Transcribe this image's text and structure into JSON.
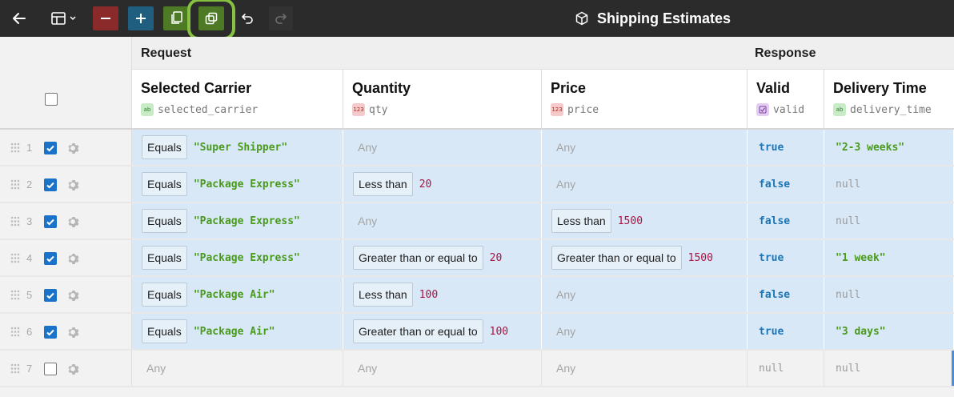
{
  "toolbar": {
    "title": "Shipping Estimates",
    "buttons": [
      "back",
      "layout",
      "delete-row",
      "add-row",
      "copy-row",
      "duplicate-row",
      "undo",
      "redo"
    ],
    "colors": {
      "bg": "#2b2b2b",
      "delete": "#8a2a2a",
      "add": "#1f5e7e",
      "copy": "#4e7a26",
      "highlight": "#86c23f"
    }
  },
  "groups": {
    "request": "Request",
    "response": "Response"
  },
  "columns": [
    {
      "name": "Selected Carrier",
      "field": "selected_carrier",
      "type_badge": "ab"
    },
    {
      "name": "Quantity",
      "field": "qty",
      "type_badge": "123"
    },
    {
      "name": "Price",
      "field": "price",
      "type_badge": "123"
    },
    {
      "name": "Valid",
      "field": "valid",
      "type_badge": "bool"
    },
    {
      "name": "Delivery Time",
      "field": "delivery_time",
      "type_badge": "ab"
    }
  ],
  "rows": [
    {
      "num": "1",
      "checked": true,
      "carrier": {
        "op": "Equals",
        "value": "\"Super Shipper\""
      },
      "qty": {
        "op": "",
        "value": "Any"
      },
      "price": {
        "op": "",
        "value": "Any"
      },
      "valid": "true",
      "delivery": "\"2-3 weeks\""
    },
    {
      "num": "2",
      "checked": true,
      "carrier": {
        "op": "Equals",
        "value": "\"Package Express\""
      },
      "qty": {
        "op": "Less than",
        "value": "20"
      },
      "price": {
        "op": "",
        "value": "Any"
      },
      "valid": "false",
      "delivery": "null"
    },
    {
      "num": "3",
      "checked": true,
      "carrier": {
        "op": "Equals",
        "value": "\"Package Express\""
      },
      "qty": {
        "op": "",
        "value": "Any"
      },
      "price": {
        "op": "Less than",
        "value": "1500"
      },
      "valid": "false",
      "delivery": "null"
    },
    {
      "num": "4",
      "checked": true,
      "carrier": {
        "op": "Equals",
        "value": "\"Package Express\""
      },
      "qty": {
        "op": "Greater than or equal to",
        "value": "20"
      },
      "price": {
        "op": "Greater than or equal to",
        "value": "1500"
      },
      "valid": "true",
      "delivery": "\"1 week\""
    },
    {
      "num": "5",
      "checked": true,
      "carrier": {
        "op": "Equals",
        "value": "\"Package Air\""
      },
      "qty": {
        "op": "Less than",
        "value": "100"
      },
      "price": {
        "op": "",
        "value": "Any"
      },
      "valid": "false",
      "delivery": "null"
    },
    {
      "num": "6",
      "checked": true,
      "carrier": {
        "op": "Equals",
        "value": "\"Package Air\""
      },
      "qty": {
        "op": "Greater than or equal to",
        "value": "100"
      },
      "price": {
        "op": "",
        "value": "Any"
      },
      "valid": "true",
      "delivery": "\"3 days\""
    },
    {
      "num": "7",
      "checked": false,
      "carrier": {
        "op": "",
        "value": "Any"
      },
      "qty": {
        "op": "",
        "value": "Any"
      },
      "price": {
        "op": "",
        "value": "Any"
      },
      "valid": "null",
      "delivery": "null"
    }
  ],
  "colors": {
    "selected_row": "#d8e8f7",
    "string": "#4a9a1c",
    "number": "#b01040",
    "boolean": "#1b76b9",
    "checkbox": "#1a73c8"
  }
}
